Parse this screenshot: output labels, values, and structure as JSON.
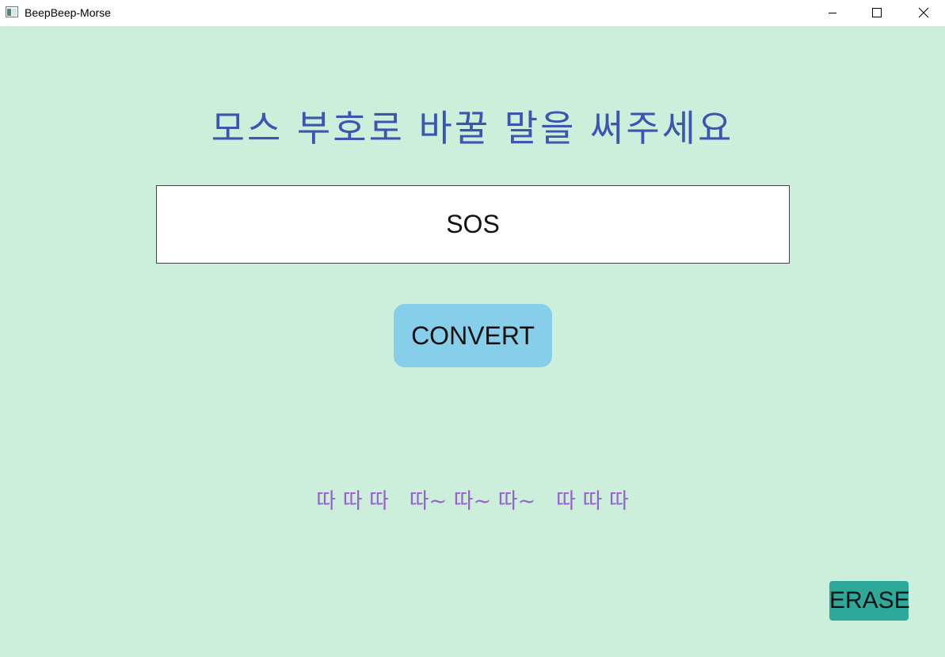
{
  "window": {
    "title": "BeepBeep-Morse",
    "app_icon": "app-window-icon",
    "controls": [
      "minimize-icon",
      "maximize-icon",
      "close-icon"
    ]
  },
  "main": {
    "prompt": "모스 부호로 바꿀 말을 써주세요",
    "input": {
      "value": "SOS",
      "placeholder": ""
    },
    "convert_label": "CONVERT",
    "morse_output": "따 따 따   따~ 따~ 따~   따 따 따",
    "erase_label": "ERASE"
  },
  "colors": {
    "background": "#cbefdb",
    "prompt_text": "#3b55b0",
    "convert_button": "#87ceeb",
    "morse_text": "#9a5fd0",
    "erase_button": "#2ea89a"
  }
}
